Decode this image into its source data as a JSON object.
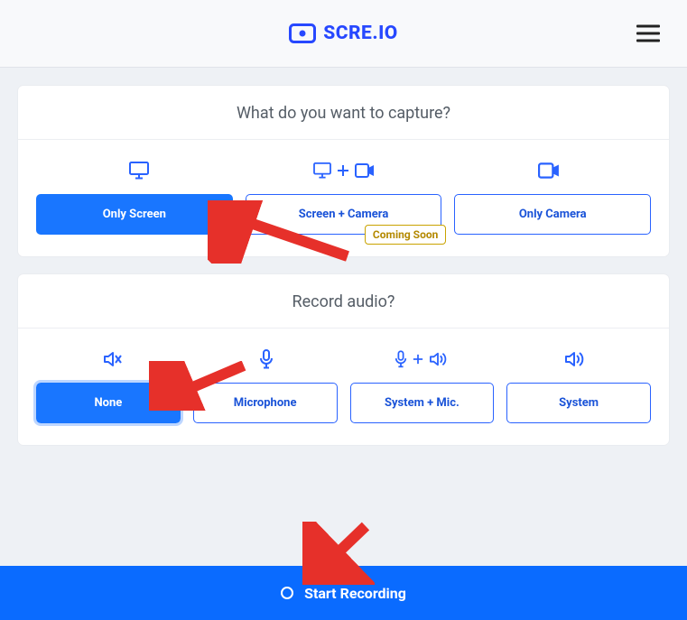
{
  "header": {
    "brand": "SCRE.IO"
  },
  "capture": {
    "title": "What do you want to capture?",
    "options": {
      "only_screen": "Only Screen",
      "screen_camera": "Screen + Camera",
      "only_camera": "Only Camera"
    },
    "badge": "Coming Soon"
  },
  "audio": {
    "title": "Record audio?",
    "options": {
      "none": "None",
      "microphone": "Microphone",
      "system_mic": "System + Mic.",
      "system": "System"
    }
  },
  "start": {
    "label": "Start Recording"
  }
}
